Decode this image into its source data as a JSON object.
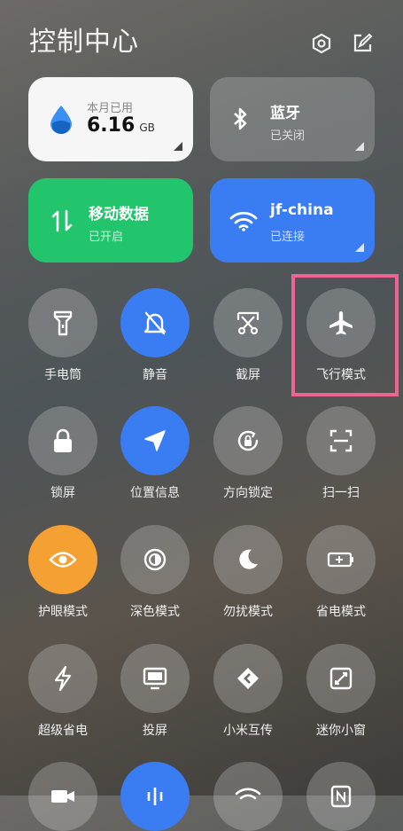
{
  "header": {
    "title": "控制中心"
  },
  "cards": {
    "data_usage": {
      "caption": "本月已用",
      "value": "6.16",
      "unit": "GB"
    },
    "bluetooth": {
      "name": "蓝牙",
      "status": "已关闭"
    },
    "mobile_data": {
      "name": "移动数据",
      "status": "已开启"
    },
    "wifi": {
      "name": "jf-china",
      "status": "已连接"
    }
  },
  "tiles": [
    {
      "label": "手电筒"
    },
    {
      "label": "静音"
    },
    {
      "label": "截屏"
    },
    {
      "label": "飞行模式"
    },
    {
      "label": "锁屏"
    },
    {
      "label": "位置信息"
    },
    {
      "label": "方向锁定"
    },
    {
      "label": "扫一扫"
    },
    {
      "label": "护眼模式"
    },
    {
      "label": "深色模式"
    },
    {
      "label": "勿扰模式"
    },
    {
      "label": "省电模式"
    },
    {
      "label": "超级省电"
    },
    {
      "label": "投屏"
    },
    {
      "label": "小米互传"
    },
    {
      "label": "迷你小窗"
    }
  ],
  "colors": {
    "accent_blue": "#3a7cf2",
    "mobile_green": "#22c56b",
    "eye_orange": "#f5a032",
    "highlight_pink": "#f06292"
  }
}
